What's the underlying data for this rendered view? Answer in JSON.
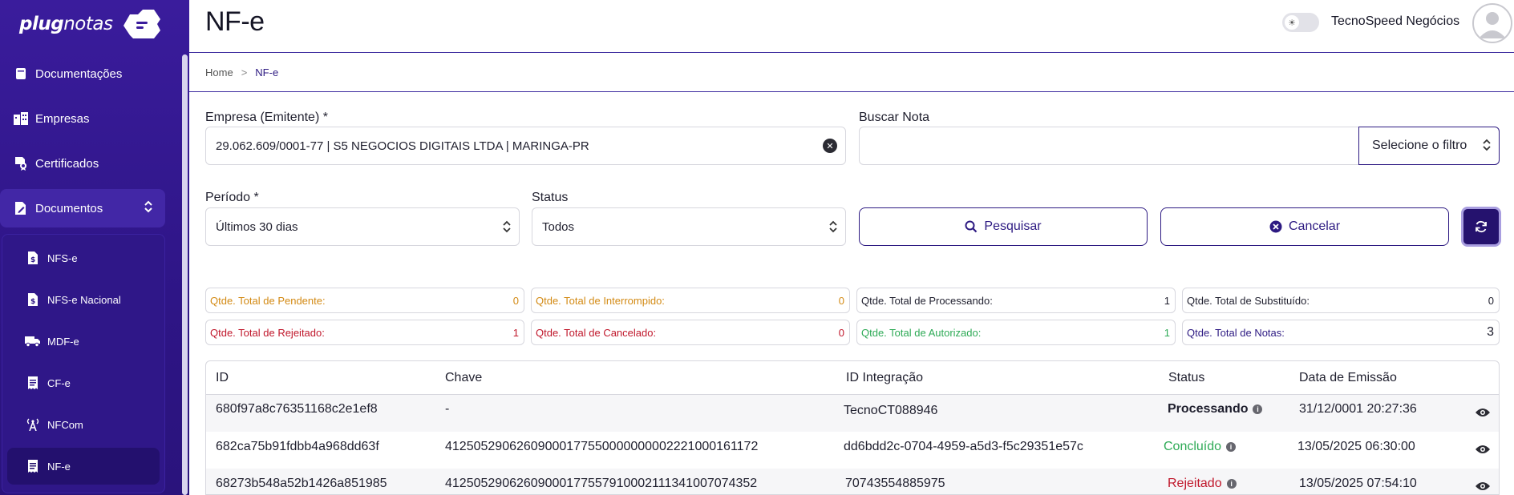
{
  "app": {
    "logo": {
      "part1": "plug",
      "part2": "notas"
    },
    "company_name": "TecnoSpeed Negócios"
  },
  "sidebar": {
    "items": [
      {
        "label": "Documentações",
        "icon": "book-icon"
      },
      {
        "label": "Empresas",
        "icon": "buildings-icon"
      },
      {
        "label": "Certificados",
        "icon": "certificate-icon"
      },
      {
        "label": "Documentos",
        "icon": "document-edit-icon"
      }
    ],
    "sub_items": [
      {
        "label": "NFS-e",
        "icon": "dollar-file-icon"
      },
      {
        "label": "NFS-e Nacional",
        "icon": "dollar-file-icon"
      },
      {
        "label": "MDF-e",
        "icon": "truck-icon"
      },
      {
        "label": "CF-e",
        "icon": "receipt-icon"
      },
      {
        "label": "NFCom",
        "icon": "antenna-icon"
      },
      {
        "label": "NF-e",
        "icon": "receipt-icon"
      }
    ]
  },
  "header": {
    "title": "NF-e"
  },
  "breadcrumb": {
    "home": "Home",
    "separator": ">",
    "current": "NF-e"
  },
  "form": {
    "empresa_label": "Empresa (Emitente) *",
    "empresa_value": "29.062.609/0001-77 | S5 NEGOCIOS DIGITAIS LTDA | MARINGA-PR",
    "buscar_label": "Buscar Nota",
    "buscar_value": "",
    "filtro_value": "Selecione o filtro",
    "periodo_label": "Período *",
    "periodo_value": "Últimos 30 dias",
    "status_label": "Status",
    "status_value": "Todos",
    "pesquisar_label": "Pesquisar",
    "cancelar_label": "Cancelar"
  },
  "stats": [
    {
      "label": "Qtde. Total de Pendente:",
      "value": "0",
      "color": "#d38a14"
    },
    {
      "label": "Qtde. Total de Interrompido:",
      "value": "0",
      "color": "#d38a14"
    },
    {
      "label": "Qtde. Total de Processando:",
      "value": "1",
      "color": "#1f1f2e"
    },
    {
      "label": "Qtde. Total de Substituído:",
      "value": "0",
      "color": "#1f1f2e"
    },
    {
      "label": "Qtde. Total de Rejeitado:",
      "value": "1",
      "color": "#c0172b"
    },
    {
      "label": "Qtde. Total de Cancelado:",
      "value": "0",
      "color": "#c0172b"
    },
    {
      "label": "Qtde. Total de Autorizado:",
      "value": "1",
      "color": "#2eaa56"
    },
    {
      "label": "Qtde. Total de Notas:",
      "value": "3",
      "color": "#2d1a82"
    }
  ],
  "table": {
    "columns": [
      "ID",
      "Chave",
      "ID Integração",
      "Status",
      "Data de Emissão"
    ],
    "rows": [
      {
        "id": "680f97a8c76351168c2e1ef8",
        "chave": "-",
        "id_integracao": "TecnoCT088946",
        "status": "Processando",
        "data": "31/12/0001 20:27:36"
      },
      {
        "id": "682ca75b91fdbb4a968dd63f",
        "chave": "41250529062609000177550000000002221000161172",
        "id_integracao": "dd6bdd2c-0704-4959-a5d3-f5c29351e57c",
        "status": "Concluído",
        "data": "13/05/2025 06:30:00"
      },
      {
        "id": "68273b548a52b1426a851985",
        "chave": "41250529062609000177557910002111341007074352",
        "id_integracao": "70743554885975",
        "status": "Rejeitado",
        "data": "13/05/2025 07:54:10"
      }
    ]
  }
}
